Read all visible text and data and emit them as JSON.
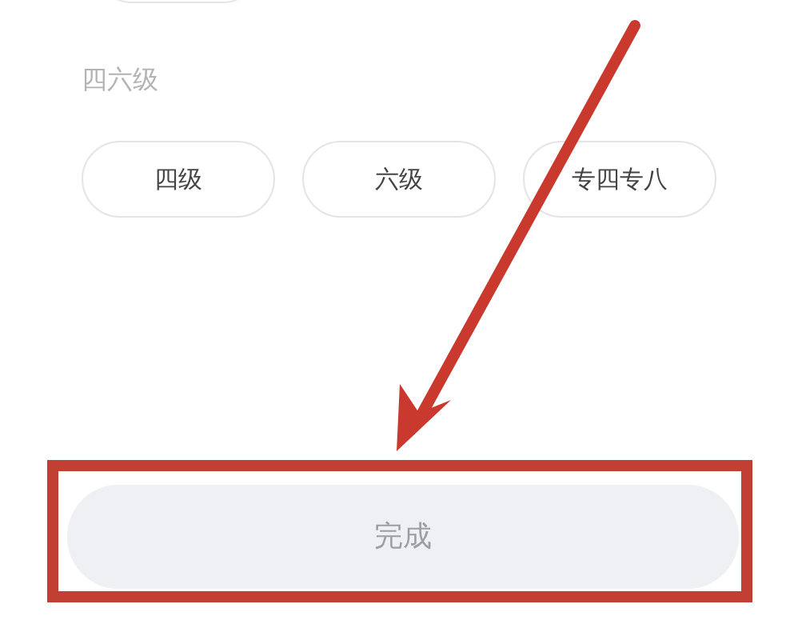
{
  "section": {
    "label": "四六级",
    "options": [
      {
        "label": "四级",
        "selected": false
      },
      {
        "label": "六级",
        "selected": false
      },
      {
        "label": "专四专八",
        "selected": false
      }
    ]
  },
  "done_button": {
    "label": "完成",
    "disabled": true
  },
  "annotation": {
    "kind": "arrow_and_frame"
  }
}
